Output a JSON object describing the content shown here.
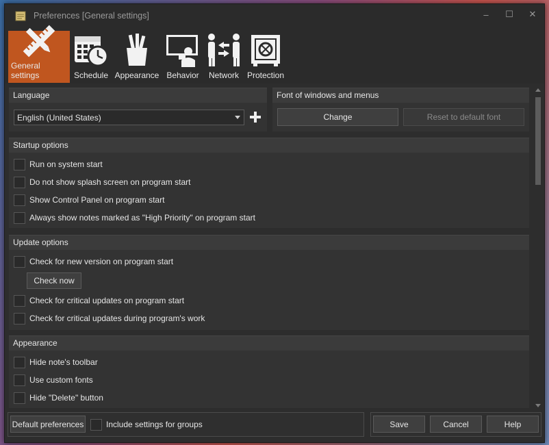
{
  "window": {
    "title": "Preferences [General settings]",
    "controls": {
      "minimize": "–",
      "maximize": "☐",
      "close": "✕"
    }
  },
  "toolbar": {
    "items": [
      {
        "label": "General settings",
        "icon": "pencil-ruler-icon",
        "active": true
      },
      {
        "label": "Schedule",
        "icon": "calendar-clock-icon",
        "active": false
      },
      {
        "label": "Appearance",
        "icon": "pencil-cup-icon",
        "active": false
      },
      {
        "label": "Behavior",
        "icon": "monitor-person-icon",
        "active": false
      },
      {
        "label": "Network",
        "icon": "people-exchange-icon",
        "active": false
      },
      {
        "label": "Protection",
        "icon": "safe-icon",
        "active": false
      }
    ],
    "active_color": "#c0561f"
  },
  "language": {
    "header": "Language",
    "selected": "English (United States)"
  },
  "font": {
    "header": "Font of windows and menus",
    "change_label": "Change",
    "reset_label": "Reset to default font"
  },
  "startup": {
    "header": "Startup options",
    "options": [
      {
        "label": "Run on system start",
        "checked": false
      },
      {
        "label": "Do not show splash screen on program start",
        "checked": false
      },
      {
        "label": "Show Control Panel on program start",
        "checked": false
      },
      {
        "label": "Always show notes marked as \"High Priority\" on program start",
        "checked": false
      }
    ]
  },
  "update": {
    "header": "Update options",
    "check_new_version": "Check for new version on program start",
    "check_now_label": "Check now",
    "critical_on_start": "Check for critical updates on program start",
    "critical_during_work": "Check for critical updates during program's work"
  },
  "appearance": {
    "header": "Appearance",
    "options": [
      {
        "label": "Hide note's toolbar",
        "checked": false
      },
      {
        "label": "Use custom fonts",
        "checked": false
      },
      {
        "label": "Hide \"Delete\" button",
        "checked": false
      }
    ]
  },
  "footer": {
    "default_prefs_label": "Default preferences",
    "include_groups_label": "Include settings for groups",
    "save_label": "Save",
    "cancel_label": "Cancel",
    "help_label": "Help"
  }
}
